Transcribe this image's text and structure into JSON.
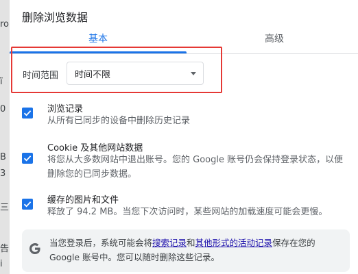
{
  "background": {
    "left_fragments": [
      "ro",
      "ï",
      "0",
      "B",
      "3",
      "三",
      "告",
      "i"
    ]
  },
  "dialog": {
    "title": "删除浏览数据",
    "tabs": [
      {
        "label": "基本",
        "active": true
      },
      {
        "label": "高级",
        "active": false
      }
    ],
    "time_range": {
      "label": "时间范围",
      "value": "时间不限"
    },
    "options": [
      {
        "title": "浏览记录",
        "desc": [
          "从所有已同步的设备中删除历史记录"
        ],
        "checked": true
      },
      {
        "title": "Cookie 及其他网站数据",
        "desc": [
          "将您从大多数网站中退出账号。您的 Google 账号仍会保持登录状态，以便",
          "删除您的已同步数据。"
        ],
        "checked": true
      },
      {
        "title": "缓存的图片和文件",
        "desc": [
          "释放了 94.2 MB。当您下次访问时，某些网站的加载速度可能会更慢。"
        ],
        "checked": true
      }
    ],
    "info": {
      "prefix": "当您登录后，系统可能会将",
      "link1": "搜索记录",
      "mid": "和",
      "link2": "其他形式的活动记录",
      "suffix1": "保存在您的",
      "line2": "Google 账号中。您可以随时删除这些记录。"
    }
  },
  "colors": {
    "accent": "#1a73e8",
    "highlight_box": "#e53935",
    "info_bg": "#f1f3f4"
  }
}
